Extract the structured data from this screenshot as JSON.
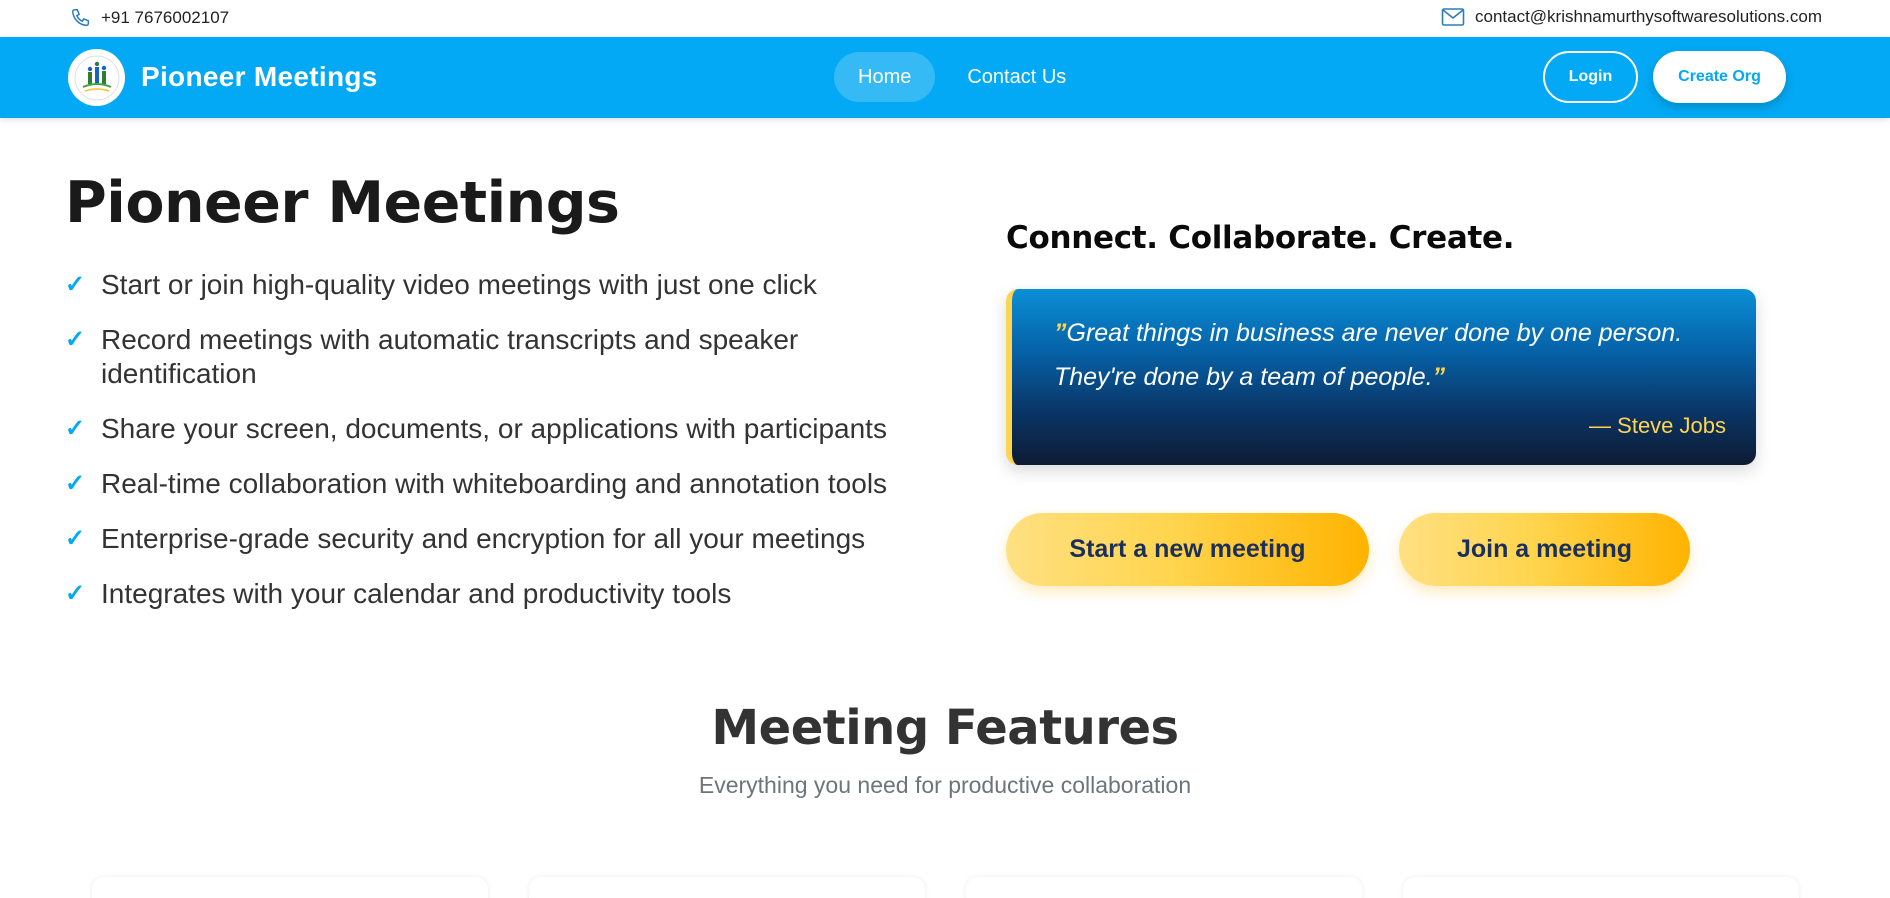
{
  "topbar": {
    "phone": "+91 7676002107",
    "email": "contact@krishnamurthysoftwaresolutions.com",
    "phone_icon": "phone-icon",
    "email_icon": "mail-icon"
  },
  "navbar": {
    "brand": "Pioneer Meetings",
    "logo_icon": "pioneer-logo-icon",
    "links": [
      {
        "label": "Home",
        "active": true
      },
      {
        "label": "Contact Us",
        "active": false
      }
    ],
    "login_label": "Login",
    "create_org_label": "Create Org"
  },
  "hero": {
    "title": "Pioneer Meetings",
    "check_icon": "check-icon",
    "features": [
      "Start or join high-quality video meetings with just one click",
      "Record meetings with automatic transcripts and speaker identification",
      "Share your screen, documents, or applications with participants",
      "Real-time collaboration with whiteboarding and annotation tools",
      "Enterprise-grade security and encryption for all your meetings",
      "Integrates with your calendar and productivity tools"
    ],
    "tagline": "Connect. Collaborate. Create.",
    "quote": {
      "open_mark": "”",
      "text": "Great things in business are never done by one person. They're done by a team of people.",
      "close_mark": "”",
      "author": "— Steve Jobs"
    },
    "start_label": "Start a new meeting",
    "join_label": "Join a meeting"
  },
  "features_section": {
    "title": "Meeting Features",
    "subtitle": "Everything you need for productive collaboration"
  },
  "colors": {
    "primary": "#03a9f4",
    "accent": "#ffd54f",
    "button_text": "#1a2f5c"
  }
}
